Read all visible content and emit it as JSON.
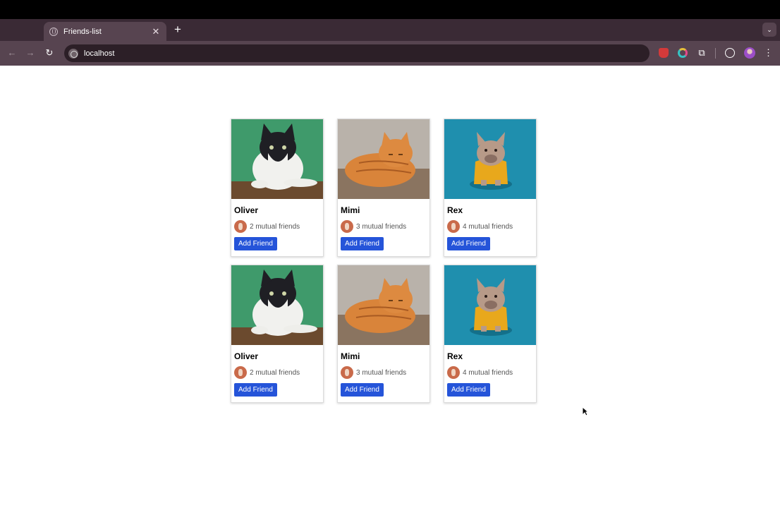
{
  "browser": {
    "tab_title": "Friends-list",
    "tab_close": "✕",
    "new_tab": "+",
    "tab_search": "⌄",
    "url": "localhost",
    "back": "←",
    "forward": "→",
    "reload": "↻",
    "extensions_icon": "⧉",
    "menu": "⋮"
  },
  "cards": [
    {
      "name": "Oliver",
      "mutual": "2 mutual friends",
      "button": "Add Friend",
      "photo": "tuxedo-cat-photo"
    },
    {
      "name": "Mimi",
      "mutual": "3 mutual friends",
      "button": "Add Friend",
      "photo": "orange-tabby-cat-photo"
    },
    {
      "name": "Rex",
      "mutual": "4 mutual friends",
      "button": "Add Friend",
      "photo": "french-bulldog-photo"
    },
    {
      "name": "Oliver",
      "mutual": "2 mutual friends",
      "button": "Add Friend",
      "photo": "tuxedo-cat-photo"
    },
    {
      "name": "Mimi",
      "mutual": "3 mutual friends",
      "button": "Add Friend",
      "photo": "orange-tabby-cat-photo"
    },
    {
      "name": "Rex",
      "mutual": "4 mutual friends",
      "button": "Add Friend",
      "photo": "french-bulldog-photo"
    }
  ],
  "colors": {
    "button": "#2554d9",
    "tab_bar": "#3a2a35",
    "toolbar": "#574450"
  }
}
